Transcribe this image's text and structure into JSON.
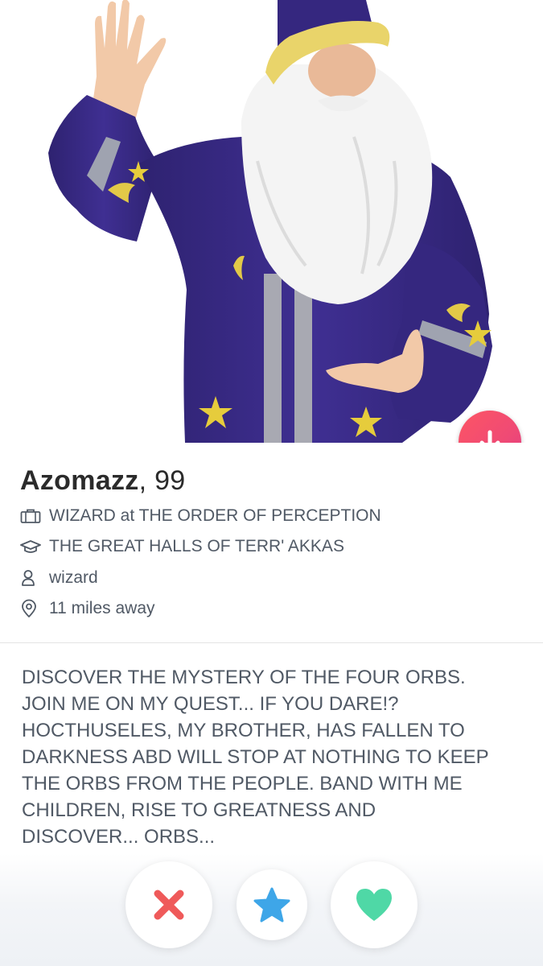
{
  "profile": {
    "name": "Azomazz",
    "age_text": ", 99",
    "job": "WIZARD at THE ORDER OF PERCEPTION",
    "school": "THE GREAT HALLS OF TERR' AKKAS",
    "username": "wizard",
    "distance": "11 miles away",
    "bio": "DISCOVER THE MYSTERY OF THE FOUR ORBS.\nJOIN ME ON MY QUEST... IF YOU DARE!?\nHOCTHUSELES, MY BROTHER, HAS FALLEN TO\nDARKNESS ABD WILL STOP AT NOTHING TO KEEP\nTHE ORBS FROM THE PEOPLE. BAND WITH ME\nCHILDREN, RISE TO GREATNESS AND\nDISCOVER... ORBS..."
  },
  "icons": {
    "job": "briefcase-icon",
    "school": "graduation-cap-icon",
    "username": "person-icon",
    "distance": "location-pin-icon",
    "expand": "arrow-down-icon",
    "nope": "x-icon",
    "super_like": "star-icon",
    "like": "heart-icon"
  },
  "colors": {
    "expand_button": "#fd5564",
    "nope": "#ef5a5a",
    "super_like": "#3ea6e8",
    "like": "#4fd8a6",
    "text_primary": "#2b2b2b",
    "text_secondary": "#505965",
    "robe": "#3b2b86"
  }
}
